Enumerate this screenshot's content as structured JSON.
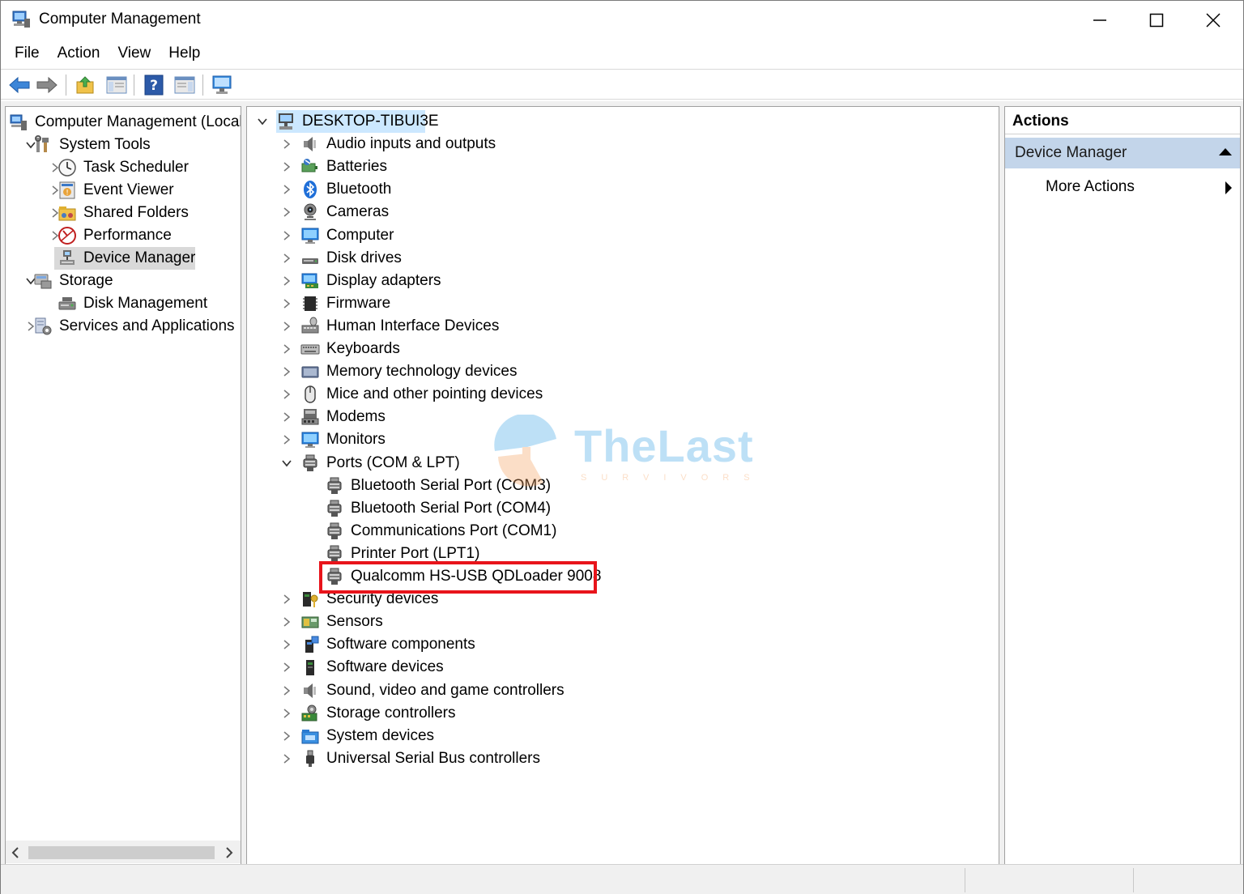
{
  "window": {
    "title": "Computer Management"
  },
  "menu": [
    "File",
    "Action",
    "View",
    "Help"
  ],
  "left_tree": [
    {
      "label": "Computer Management (Local",
      "icon": "computer-management-icon",
      "level": 0,
      "chevron": "none"
    },
    {
      "label": "System Tools",
      "icon": "tools-icon",
      "level": 1,
      "chevron": "expanded"
    },
    {
      "label": "Task Scheduler",
      "icon": "clock-icon",
      "level": 2,
      "chevron": "collapsed"
    },
    {
      "label": "Event Viewer",
      "icon": "event-viewer-icon",
      "level": 2,
      "chevron": "collapsed"
    },
    {
      "label": "Shared Folders",
      "icon": "shared-folder-icon",
      "level": 2,
      "chevron": "collapsed"
    },
    {
      "label": "Performance",
      "icon": "performance-icon",
      "level": 2,
      "chevron": "collapsed"
    },
    {
      "label": "Device Manager",
      "icon": "device-manager-icon",
      "level": 2,
      "chevron": "none",
      "selected": true
    },
    {
      "label": "Storage",
      "icon": "storage-icon",
      "level": 1,
      "chevron": "expanded"
    },
    {
      "label": "Disk Management",
      "icon": "disk-management-icon",
      "level": 2,
      "chevron": "none"
    },
    {
      "label": "Services and Applications",
      "icon": "services-icon",
      "level": 1,
      "chevron": "collapsed"
    }
  ],
  "device_tree": {
    "root": "DESKTOP-TIBUI3E",
    "categories": [
      {
        "label": "Audio inputs and outputs",
        "icon": "speaker-icon"
      },
      {
        "label": "Batteries",
        "icon": "battery-icon"
      },
      {
        "label": "Bluetooth",
        "icon": "bluetooth-icon"
      },
      {
        "label": "Cameras",
        "icon": "camera-icon"
      },
      {
        "label": "Computer",
        "icon": "monitor-icon"
      },
      {
        "label": "Disk drives",
        "icon": "disk-drive-icon"
      },
      {
        "label": "Display adapters",
        "icon": "display-adapter-icon"
      },
      {
        "label": "Firmware",
        "icon": "firmware-icon"
      },
      {
        "label": "Human Interface Devices",
        "icon": "hid-icon"
      },
      {
        "label": "Keyboards",
        "icon": "keyboard-icon"
      },
      {
        "label": "Memory technology devices",
        "icon": "memory-icon"
      },
      {
        "label": "Mice and other pointing devices",
        "icon": "mouse-icon"
      },
      {
        "label": "Modems",
        "icon": "modem-icon"
      },
      {
        "label": "Monitors",
        "icon": "monitor-icon"
      },
      {
        "label": "Ports (COM & LPT)",
        "icon": "port-icon",
        "expanded": true,
        "children": [
          {
            "label": "Bluetooth Serial Port (COM3)",
            "icon": "port-icon"
          },
          {
            "label": "Bluetooth Serial Port (COM4)",
            "icon": "port-icon"
          },
          {
            "label": "Communications Port (COM1)",
            "icon": "port-icon"
          },
          {
            "label": "Printer Port (LPT1)",
            "icon": "port-icon"
          },
          {
            "label": "Qualcomm HS-USB QDLoader 9008",
            "icon": "port-icon",
            "highlighted": true
          }
        ]
      },
      {
        "label": "Security devices",
        "icon": "security-icon"
      },
      {
        "label": "Sensors",
        "icon": "sensor-icon"
      },
      {
        "label": "Software components",
        "icon": "software-component-icon"
      },
      {
        "label": "Software devices",
        "icon": "software-device-icon"
      },
      {
        "label": "Sound, video and game controllers",
        "icon": "speaker-icon"
      },
      {
        "label": "Storage controllers",
        "icon": "storage-controller-icon"
      },
      {
        "label": "System devices",
        "icon": "system-folder-icon"
      },
      {
        "label": "Universal Serial Bus controllers",
        "icon": "usb-icon"
      }
    ]
  },
  "actions": {
    "header": "Actions",
    "section": "Device Manager",
    "more": "More Actions"
  },
  "watermark": {
    "text": "TheLast",
    "sub": "SURVIVORS"
  },
  "colors": {
    "selection": "#cce8ff",
    "inactive_selection": "#d9d9d9",
    "highlight_box": "#e8141b",
    "actions_section": "#c3d5ea"
  }
}
